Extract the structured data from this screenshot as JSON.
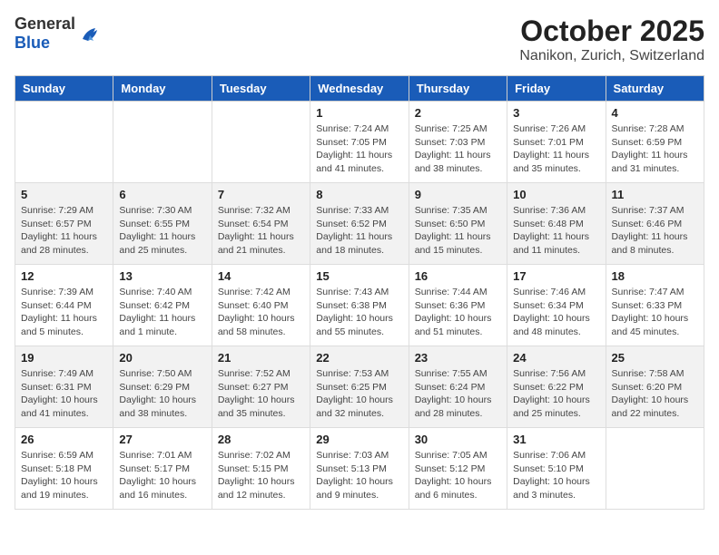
{
  "header": {
    "logo_general": "General",
    "logo_blue": "Blue",
    "month": "October 2025",
    "location": "Nanikon, Zurich, Switzerland"
  },
  "weekdays": [
    "Sunday",
    "Monday",
    "Tuesday",
    "Wednesday",
    "Thursday",
    "Friday",
    "Saturday"
  ],
  "weeks": [
    [
      {
        "day": "",
        "info": ""
      },
      {
        "day": "",
        "info": ""
      },
      {
        "day": "",
        "info": ""
      },
      {
        "day": "1",
        "info": "Sunrise: 7:24 AM\nSunset: 7:05 PM\nDaylight: 11 hours\nand 41 minutes."
      },
      {
        "day": "2",
        "info": "Sunrise: 7:25 AM\nSunset: 7:03 PM\nDaylight: 11 hours\nand 38 minutes."
      },
      {
        "day": "3",
        "info": "Sunrise: 7:26 AM\nSunset: 7:01 PM\nDaylight: 11 hours\nand 35 minutes."
      },
      {
        "day": "4",
        "info": "Sunrise: 7:28 AM\nSunset: 6:59 PM\nDaylight: 11 hours\nand 31 minutes."
      }
    ],
    [
      {
        "day": "5",
        "info": "Sunrise: 7:29 AM\nSunset: 6:57 PM\nDaylight: 11 hours\nand 28 minutes."
      },
      {
        "day": "6",
        "info": "Sunrise: 7:30 AM\nSunset: 6:55 PM\nDaylight: 11 hours\nand 25 minutes."
      },
      {
        "day": "7",
        "info": "Sunrise: 7:32 AM\nSunset: 6:54 PM\nDaylight: 11 hours\nand 21 minutes."
      },
      {
        "day": "8",
        "info": "Sunrise: 7:33 AM\nSunset: 6:52 PM\nDaylight: 11 hours\nand 18 minutes."
      },
      {
        "day": "9",
        "info": "Sunrise: 7:35 AM\nSunset: 6:50 PM\nDaylight: 11 hours\nand 15 minutes."
      },
      {
        "day": "10",
        "info": "Sunrise: 7:36 AM\nSunset: 6:48 PM\nDaylight: 11 hours\nand 11 minutes."
      },
      {
        "day": "11",
        "info": "Sunrise: 7:37 AM\nSunset: 6:46 PM\nDaylight: 11 hours\nand 8 minutes."
      }
    ],
    [
      {
        "day": "12",
        "info": "Sunrise: 7:39 AM\nSunset: 6:44 PM\nDaylight: 11 hours\nand 5 minutes."
      },
      {
        "day": "13",
        "info": "Sunrise: 7:40 AM\nSunset: 6:42 PM\nDaylight: 11 hours\nand 1 minute."
      },
      {
        "day": "14",
        "info": "Sunrise: 7:42 AM\nSunset: 6:40 PM\nDaylight: 10 hours\nand 58 minutes."
      },
      {
        "day": "15",
        "info": "Sunrise: 7:43 AM\nSunset: 6:38 PM\nDaylight: 10 hours\nand 55 minutes."
      },
      {
        "day": "16",
        "info": "Sunrise: 7:44 AM\nSunset: 6:36 PM\nDaylight: 10 hours\nand 51 minutes."
      },
      {
        "day": "17",
        "info": "Sunrise: 7:46 AM\nSunset: 6:34 PM\nDaylight: 10 hours\nand 48 minutes."
      },
      {
        "day": "18",
        "info": "Sunrise: 7:47 AM\nSunset: 6:33 PM\nDaylight: 10 hours\nand 45 minutes."
      }
    ],
    [
      {
        "day": "19",
        "info": "Sunrise: 7:49 AM\nSunset: 6:31 PM\nDaylight: 10 hours\nand 41 minutes."
      },
      {
        "day": "20",
        "info": "Sunrise: 7:50 AM\nSunset: 6:29 PM\nDaylight: 10 hours\nand 38 minutes."
      },
      {
        "day": "21",
        "info": "Sunrise: 7:52 AM\nSunset: 6:27 PM\nDaylight: 10 hours\nand 35 minutes."
      },
      {
        "day": "22",
        "info": "Sunrise: 7:53 AM\nSunset: 6:25 PM\nDaylight: 10 hours\nand 32 minutes."
      },
      {
        "day": "23",
        "info": "Sunrise: 7:55 AM\nSunset: 6:24 PM\nDaylight: 10 hours\nand 28 minutes."
      },
      {
        "day": "24",
        "info": "Sunrise: 7:56 AM\nSunset: 6:22 PM\nDaylight: 10 hours\nand 25 minutes."
      },
      {
        "day": "25",
        "info": "Sunrise: 7:58 AM\nSunset: 6:20 PM\nDaylight: 10 hours\nand 22 minutes."
      }
    ],
    [
      {
        "day": "26",
        "info": "Sunrise: 6:59 AM\nSunset: 5:18 PM\nDaylight: 10 hours\nand 19 minutes."
      },
      {
        "day": "27",
        "info": "Sunrise: 7:01 AM\nSunset: 5:17 PM\nDaylight: 10 hours\nand 16 minutes."
      },
      {
        "day": "28",
        "info": "Sunrise: 7:02 AM\nSunset: 5:15 PM\nDaylight: 10 hours\nand 12 minutes."
      },
      {
        "day": "29",
        "info": "Sunrise: 7:03 AM\nSunset: 5:13 PM\nDaylight: 10 hours\nand 9 minutes."
      },
      {
        "day": "30",
        "info": "Sunrise: 7:05 AM\nSunset: 5:12 PM\nDaylight: 10 hours\nand 6 minutes."
      },
      {
        "day": "31",
        "info": "Sunrise: 7:06 AM\nSunset: 5:10 PM\nDaylight: 10 hours\nand 3 minutes."
      },
      {
        "day": "",
        "info": ""
      }
    ]
  ]
}
